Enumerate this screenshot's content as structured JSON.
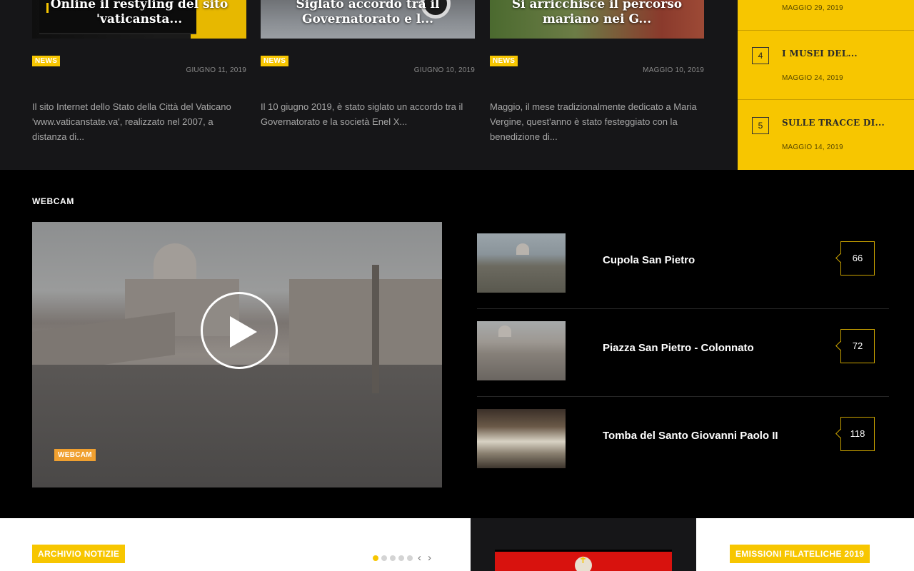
{
  "news": [
    {
      "thumb_title": "Online il restyling del sito 'vaticansta...",
      "badge": "NEWS",
      "date": "GIUGNO 11, 2019",
      "excerpt": "Il sito Internet dello Stato della Città del Vaticano 'www.vaticanstate.va', realizzato nel 2007, a distanza di..."
    },
    {
      "thumb_title": "Siglato accordo tra il Governatorato e l...",
      "badge": "NEWS",
      "date": "GIUGNO 10, 2019",
      "excerpt": "Il 10 giugno 2019, è stato siglato un accordo tra il Governatorato e la società Enel X..."
    },
    {
      "thumb_title": "Si arricchisce il percorso mariano nei G...",
      "badge": "NEWS",
      "date": "MAGGIO 10, 2019",
      "excerpt": "Maggio, il mese tradizionalmente dedicato a Maria Vergine, quest'anno è stato festeggiato con la benedizione di..."
    }
  ],
  "sidebar": {
    "top_date": "MAGGIO 29, 2019",
    "items": [
      {
        "num": "4",
        "title": "I MUSEI DEL...",
        "date": "MAGGIO 24, 2019"
      },
      {
        "num": "5",
        "title": "SULLE TRACCE DI...",
        "date": "MAGGIO 14, 2019"
      }
    ]
  },
  "webcam": {
    "section_title": "WEBCAM",
    "video_badge": "WEBCAM",
    "cams": [
      {
        "name": "Cupola San Pietro",
        "count": "66"
      },
      {
        "name": "Piazza San Pietro - Colonnato",
        "count": "72"
      },
      {
        "name": "Tomba del Santo Giovanni Paolo II",
        "count": "118"
      }
    ]
  },
  "bottom": {
    "left_badge": "ARCHIVIO NOTIZIE",
    "right_badge": "EMISSIONI FILATELICHE 2019",
    "carousel": {
      "dot_count": 5,
      "active_index": 0,
      "prev_arrow": "‹",
      "next_arrow": "›"
    }
  },
  "colors": {
    "accent_yellow": "#f7c600",
    "webcam_badge": "#f0a030",
    "news_bg": "#161618",
    "webcam_bg": "#000000"
  },
  "icons": [
    "play-icon",
    "chevron-left-icon",
    "chevron-right-icon"
  ]
}
